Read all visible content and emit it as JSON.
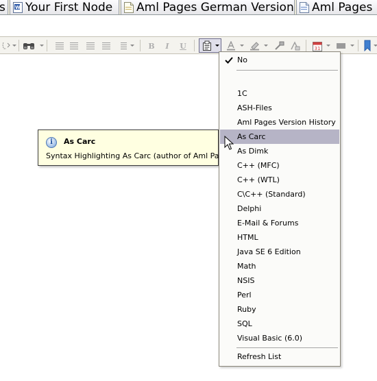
{
  "tabs": [
    {
      "label": "s",
      "icon": "page-icon"
    },
    {
      "label": "Your First Node",
      "icon": "word-doc-icon"
    },
    {
      "label": "Aml Pages German Version",
      "icon": "page-icon"
    },
    {
      "label": "Aml Pages",
      "icon": "page-icon"
    }
  ],
  "toolbar": {
    "icons": [
      "undo-redo-icon",
      "find-icon",
      "align-left-icon",
      "align-center-icon",
      "align-right-icon",
      "justify-icon",
      "line-spacing-icon",
      "bold-icon",
      "italic-icon",
      "underline-icon",
      "syntax-highlight-icon",
      "font-color-icon",
      "highlight-color-icon",
      "format-painter-icon",
      "clear-format-icon",
      "calendar-icon",
      "rectangle-icon",
      "bookmark-icon"
    ],
    "bold_label": "B",
    "italic_label": "I",
    "underline_label": "U",
    "calendar_label": "31"
  },
  "tooltip": {
    "icon": "info-icon",
    "title": "As Carc",
    "body": "Syntax Highlighting As Carc (author of Aml Pages)"
  },
  "menu": {
    "checked_item": "No",
    "items": [
      "1C",
      "ASH-Files",
      "Aml Pages Version History",
      "As Carc",
      "As Dimk",
      "C++ (MFC)",
      "C++ (WTL)",
      "C\\C++ (Standard)",
      "Delphi",
      "E-Mail & Forums",
      "HTML",
      "Java SE 6 Edition",
      "Math",
      "NSIS",
      "Perl",
      "Ruby",
      "SQL",
      "Visual Basic (6.0)"
    ],
    "highlighted_item": "As Carc",
    "refresh_label": "Refresh List"
  },
  "colors": {
    "menu_highlight": "#b6b4c6",
    "tooltip_background": "#ffffe1",
    "toolbar_background": "#f4f3ee"
  }
}
